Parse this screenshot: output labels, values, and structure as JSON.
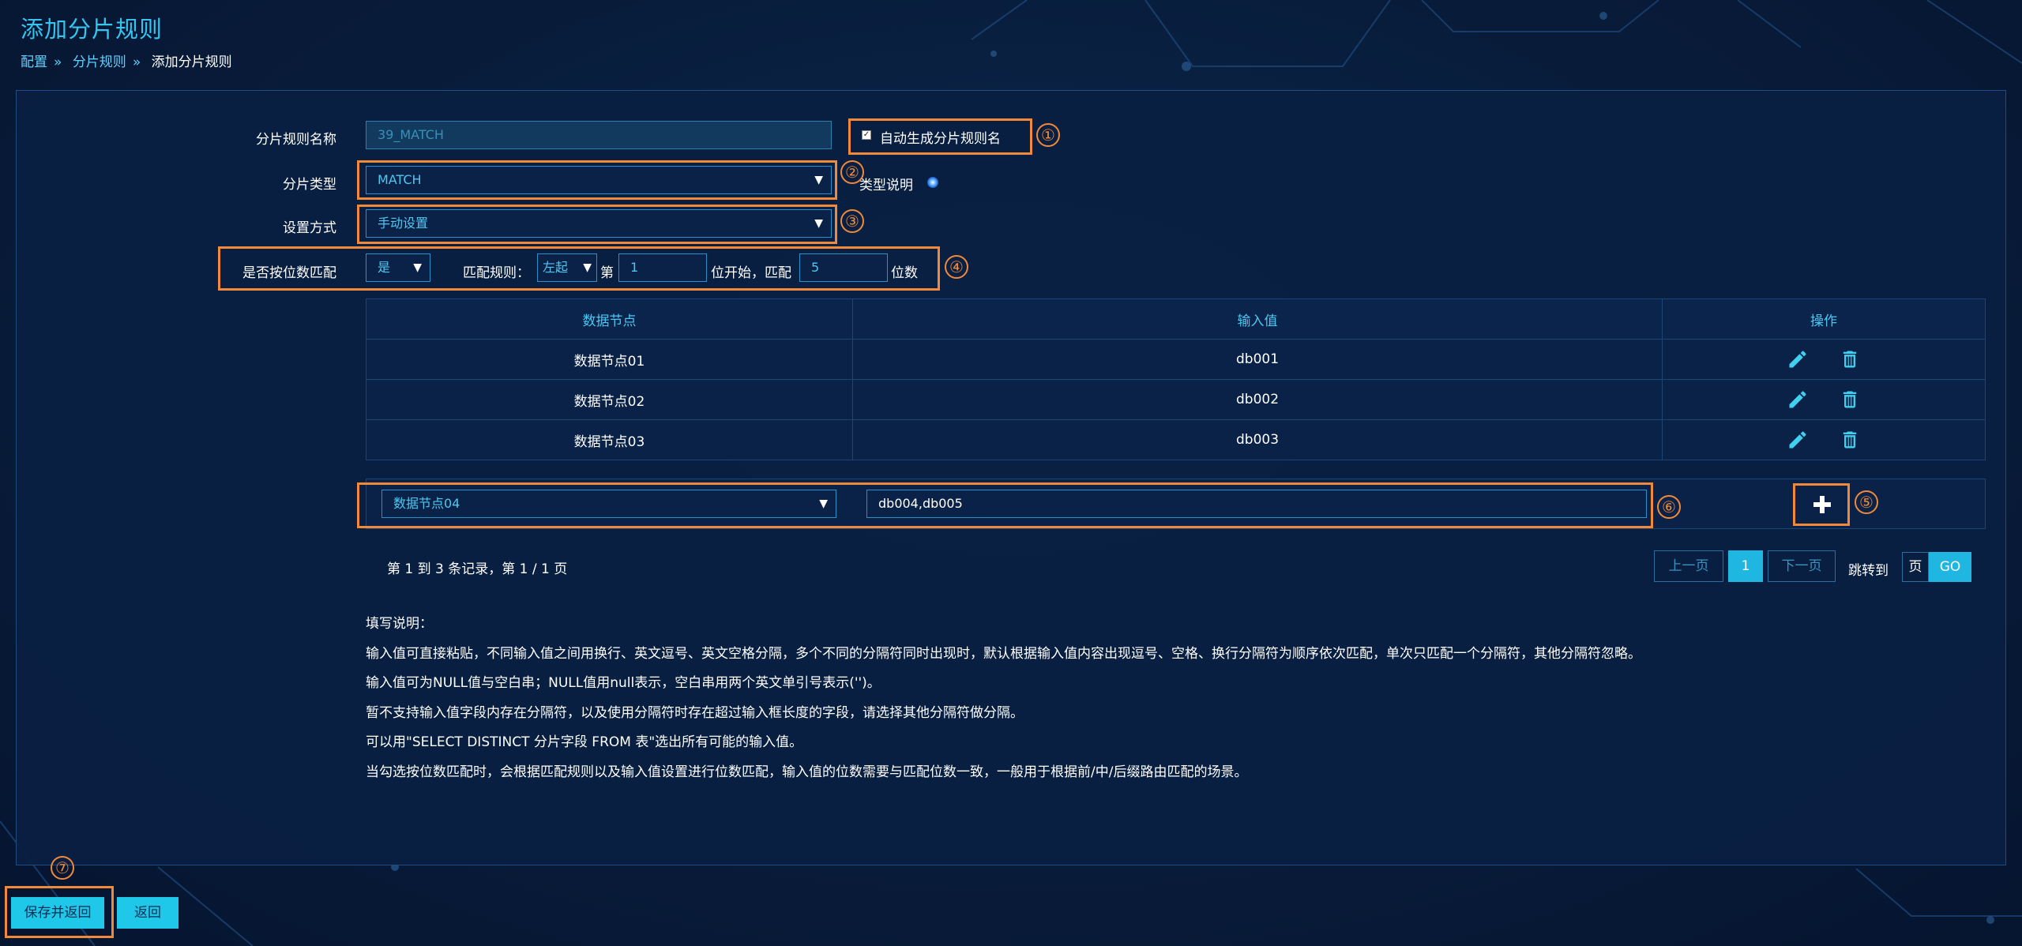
{
  "page": {
    "title": "添加分片规则",
    "breadcrumb": [
      "配置",
      "»",
      "分片规则",
      "»",
      "添加分片规则"
    ]
  },
  "form": {
    "rule_name_label": "分片规则名称",
    "rule_name_value": "39_MATCH",
    "auto_name_label": "自动生成分片规则名",
    "auto_name_checked": true,
    "shard_type_label": "分片类型",
    "shard_type_value": "MATCH",
    "type_desc_label": "类型说明",
    "setting_mode_label": "设置方式",
    "setting_mode_value": "手动设置",
    "digit_match_label": "是否按位数匹配",
    "digit_match_value": "是",
    "match_rule_label": "匹配规则：",
    "match_rule_value": "左起",
    "nth_label": "第",
    "start_pos": "1",
    "start_suffix": "位开始，匹配",
    "match_digits": "5",
    "digits_suffix": "位数"
  },
  "table": {
    "headers": [
      "数据节点",
      "输入值",
      "操作"
    ],
    "rows": [
      {
        "node": "数据节点01",
        "value": "db001"
      },
      {
        "node": "数据节点02",
        "value": "db002"
      },
      {
        "node": "数据节点03",
        "value": "db003"
      }
    ]
  },
  "add_row": {
    "node_value": "数据节点04",
    "input_value": "db004,db005"
  },
  "pager": {
    "summary": "第 1 到 3 条记录，第 1 / 1 页",
    "prev": "上一页",
    "current": "1",
    "next": "下一页",
    "jump_label": "跳转到",
    "page_placeholder": "页",
    "go": "GO"
  },
  "notes": {
    "title": "填写说明：",
    "lines": [
      "输入值可直接粘贴，不同输入值之间用换行、英文逗号、英文空格分隔，多个不同的分隔符同时出现时，默认根据输入值内容出现逗号、空格、换行分隔符为顺序依次匹配，单次只匹配一个分隔符，其他分隔符忽略。",
      "输入值可为NULL值与空白串；NULL值用null表示，空白串用两个英文单引号表示('')。",
      "暂不支持输入值字段内存在分隔符，以及使用分隔符时存在超过输入框长度的字段，请选择其他分隔符做分隔。",
      "可以用\"SELECT DISTINCT 分片字段 FROM 表\"选出所有可能的输入值。",
      "当勾选按位数匹配时，会根据匹配规则以及输入值设置进行位数匹配，输入值的位数需要与匹配位数一致，一般用于根据前/中/后缀路由匹配的场景。"
    ]
  },
  "footer": {
    "save_label": "保存并返回",
    "back_label": "返回"
  },
  "annotations": [
    "①",
    "②",
    "③",
    "④",
    "⑤",
    "⑥",
    "⑦"
  ],
  "colors": {
    "accent": "#1fc7e8",
    "title": "#36c5f0",
    "highlight": "#f08a3a",
    "background": "#081c3a"
  }
}
